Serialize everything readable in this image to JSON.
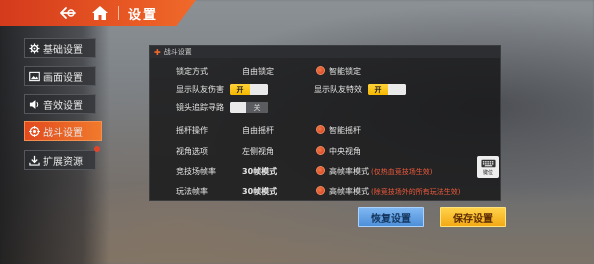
{
  "header": {
    "title": "设置",
    "back_icon": "back-arrow-icon",
    "home_icon": "home-icon"
  },
  "sidebar": {
    "items": [
      {
        "label": "基础设置",
        "icon": "gear-icon"
      },
      {
        "label": "画面设置",
        "icon": "image-icon"
      },
      {
        "label": "音效设置",
        "icon": "speaker-icon"
      },
      {
        "label": "战斗设置",
        "icon": "target-icon",
        "active": true
      },
      {
        "label": "扩展资源",
        "icon": "download-icon",
        "badge": true
      }
    ]
  },
  "panel": {
    "title": "战斗设置",
    "rows": {
      "lock_mode": {
        "label": "锁定方式",
        "opt_a": "自由锁定",
        "opt_b": "智能锁定",
        "selected": "opt_b"
      },
      "show_team_damage": {
        "label": "显示队友伤害",
        "toggle_text": "开",
        "state": "on"
      },
      "show_team_effects": {
        "label": "显示队友特效",
        "toggle_text": "开",
        "state": "on"
      },
      "camera_tracking": {
        "label": "镜头追踪寻路",
        "toggle_text": "关",
        "state": "off"
      },
      "joystick": {
        "label": "摇杆操作",
        "opt_a": "自由摇杆",
        "opt_b": "智能摇杆",
        "selected": "opt_b"
      },
      "view_option": {
        "label": "视角选项",
        "opt_a": "左侧视角",
        "opt_b": "中央视角",
        "selected": "opt_b"
      },
      "arena_fps": {
        "label": "竞技场帧率",
        "opt_a": "30帧模式",
        "opt_b": "高帧率模式",
        "hint": "(仅热血竞技场生效)",
        "selected": "opt_b"
      },
      "gameplay_fps": {
        "label": "玩法帧率",
        "opt_a": "30帧模式",
        "opt_b": "高帧率模式",
        "hint": "(除竞技场外的所有玩法生效)",
        "selected": "opt_b"
      }
    },
    "keyboard_label": "键位",
    "keyboard_icon": "keyboard-icon"
  },
  "buttons": {
    "reset": "恢复设置",
    "save": "保存设置"
  },
  "colors": {
    "accent": "#e9532a",
    "toggle_on": "#f5b800",
    "reset_button": "#5a9be0",
    "save_button": "#f5b21f"
  }
}
